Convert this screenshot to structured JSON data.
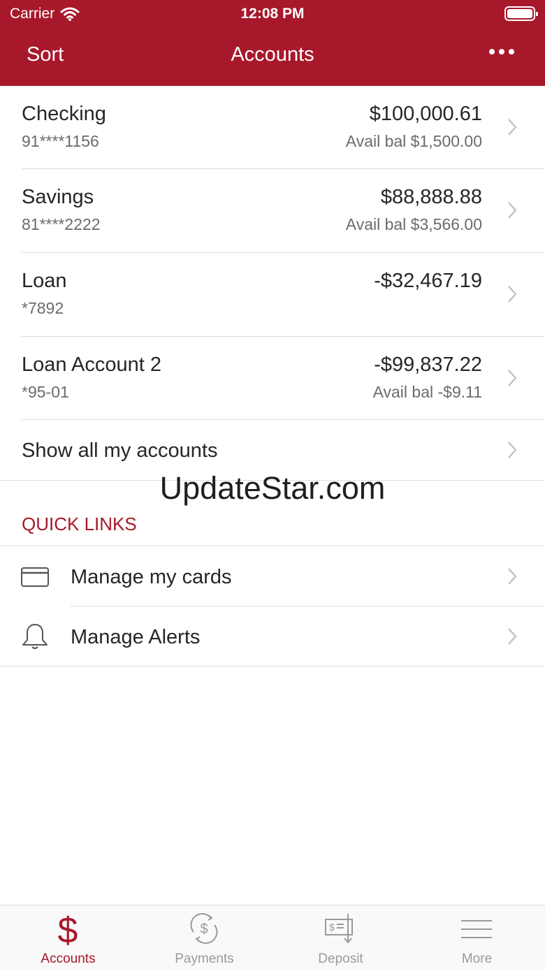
{
  "status": {
    "carrier": "Carrier",
    "time": "12:08 PM"
  },
  "nav": {
    "sort": "Sort",
    "title": "Accounts"
  },
  "accounts": [
    {
      "name": "Checking",
      "number": "91****1156",
      "balance": "$100,000.61",
      "avail": "Avail bal $1,500.00"
    },
    {
      "name": "Savings",
      "number": "81****2222",
      "balance": "$88,888.88",
      "avail": "Avail bal $3,566.00"
    },
    {
      "name": "Loan",
      "number": "*7892",
      "balance": "-$32,467.19",
      "avail": ""
    },
    {
      "name": "Loan Account 2",
      "number": "*95-01",
      "balance": "-$99,837.22",
      "avail": "Avail bal -$9.11"
    }
  ],
  "show_all": "Show all my accounts",
  "watermark": "UpdateStar.com",
  "quick_links": {
    "title": "QUICK LINKS",
    "items": [
      {
        "label": "Manage my cards",
        "icon": "credit-card-icon"
      },
      {
        "label": "Manage Alerts",
        "icon": "bell-icon"
      }
    ]
  },
  "tabs": [
    {
      "label": "Accounts",
      "icon": "dollar-icon",
      "active": true
    },
    {
      "label": "Payments",
      "icon": "payments-icon",
      "active": false
    },
    {
      "label": "Deposit",
      "icon": "deposit-check-icon",
      "active": false
    },
    {
      "label": "More",
      "icon": "menu-icon",
      "active": false
    }
  ],
  "colors": {
    "brand": "#a8182b",
    "inactive_tab": "#9a9a9a"
  }
}
